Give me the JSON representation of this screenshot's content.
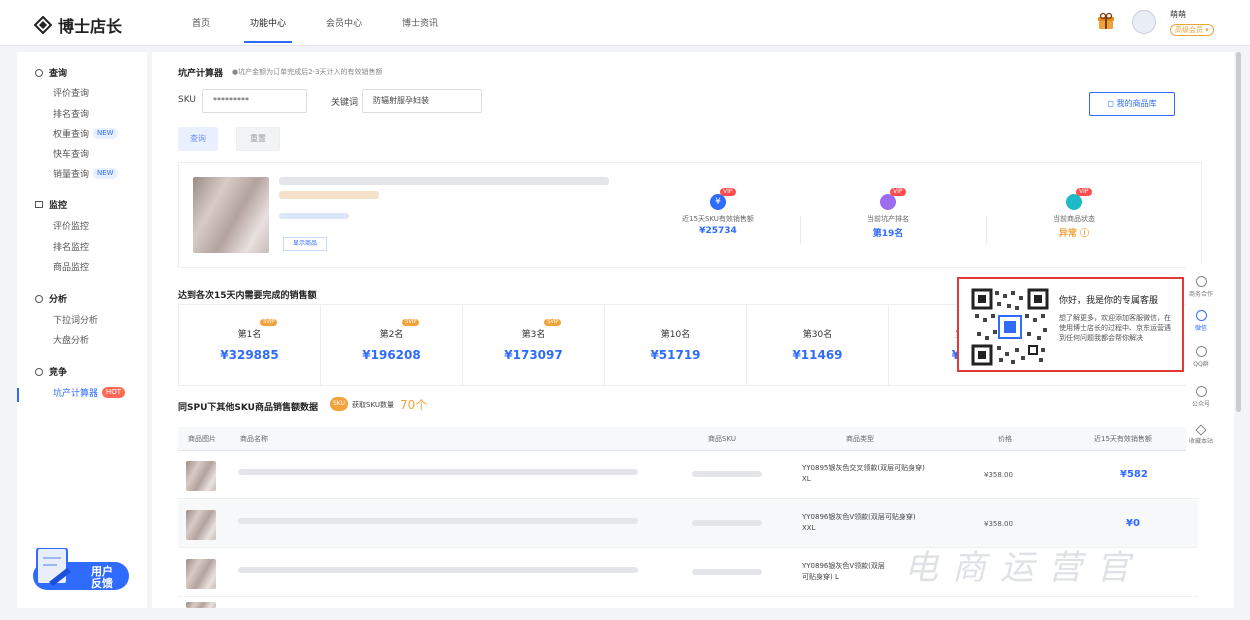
{
  "header": {
    "logo_text": "博士店长",
    "nav": [
      "首页",
      "功能中心",
      "会员中心",
      "博士资讯"
    ],
    "user_name": "萌萌",
    "user_level": "高级会员 ▾"
  },
  "sidebar": {
    "groups": [
      {
        "title": "查询",
        "items": [
          {
            "label": "评价查询",
            "badge": ""
          },
          {
            "label": "排名查询",
            "badge": ""
          },
          {
            "label": "权重查询",
            "badge": "NEW"
          },
          {
            "label": "快车查询",
            "badge": ""
          },
          {
            "label": "销量查询",
            "badge": "NEW"
          }
        ]
      },
      {
        "title": "监控",
        "items": [
          {
            "label": "评价监控",
            "badge": ""
          },
          {
            "label": "排名监控",
            "badge": ""
          },
          {
            "label": "商品监控",
            "badge": ""
          }
        ]
      },
      {
        "title": "分析",
        "items": [
          {
            "label": "下拉词分析",
            "badge": ""
          },
          {
            "label": "大盘分析",
            "badge": ""
          }
        ]
      },
      {
        "title": "竞争",
        "items": [
          {
            "label": "坑产计算器",
            "badge": "HOT"
          }
        ]
      }
    ],
    "feedback": [
      "用户",
      "反馈"
    ]
  },
  "calculator": {
    "title": "坑产计算器",
    "note": "●坑产金额为订单完成后2-3天计入的有效销售额",
    "sku_label": "SKU",
    "sku_value": "*********",
    "keyword_label": "关键词",
    "keyword_value": "防辐射服孕妇装",
    "query_btn": "查询",
    "reset_btn": "重置",
    "my_library_btn": "我的商品库"
  },
  "product": {
    "view_btn": "显示商品",
    "stats": [
      {
        "label": "近15天SKU有效销售额",
        "value": "¥25734",
        "badge": "VIP",
        "icon": "yen-icon",
        "color": "#2f6bff"
      },
      {
        "label": "当前坑产排名",
        "value": "第19名",
        "badge": "VIP",
        "icon": "rank-icon",
        "color": "#9b6cf0"
      },
      {
        "label": "当前商品状态",
        "value": "异常 ⓘ",
        "badge": "VIP",
        "icon": "shield-icon",
        "color": "#1fb9c7"
      }
    ]
  },
  "ranks": {
    "title": "达到各次15天内需要完成的销售额",
    "items": [
      {
        "name": "第1名",
        "value": "¥329885",
        "svip": "SVIP"
      },
      {
        "name": "第2名",
        "value": "¥196208",
        "svip": "SVIP"
      },
      {
        "name": "第3名",
        "value": "¥173097",
        "svip": "SVIP"
      },
      {
        "name": "第10名",
        "value": "¥51719",
        "svip": ""
      },
      {
        "name": "第30名",
        "value": "¥11469",
        "svip": ""
      },
      {
        "name": "第",
        "value": "¥5",
        "svip": ""
      }
    ]
  },
  "table": {
    "title": "同SPU下其他SKU商品销售额数据",
    "sku_chip": "SKU",
    "count_label": "获取SKU数量",
    "count_value": "70个",
    "headers": [
      "商品图片",
      "商品名称",
      "商品SKU",
      "商品类型",
      "价格",
      "近15天有效销售额"
    ],
    "rows": [
      {
        "type": "YY0895银灰色交叉领款(双层可贴身穿)  XL",
        "price": "¥358.00",
        "sales": "¥582"
      },
      {
        "type": "YY0896银灰色V领款(双层可贴身穿)  XXL",
        "price": "¥358.00",
        "sales": "¥0"
      },
      {
        "type": "YY0896银灰色V领款(双层可贴身穿)  L",
        "price": "",
        "sales": ""
      }
    ]
  },
  "customer_service": {
    "title": "你好，我是你的专属客服",
    "desc": "想了解更多，欢迎添加客服微信，在使用博士店长的过程中、京东运营遇到任何问题我都会帮你解决"
  },
  "right_rail": [
    "商务合作",
    "微信",
    "QQ群",
    "公众号",
    "收藏本站"
  ],
  "watermark": "电商运营官"
}
